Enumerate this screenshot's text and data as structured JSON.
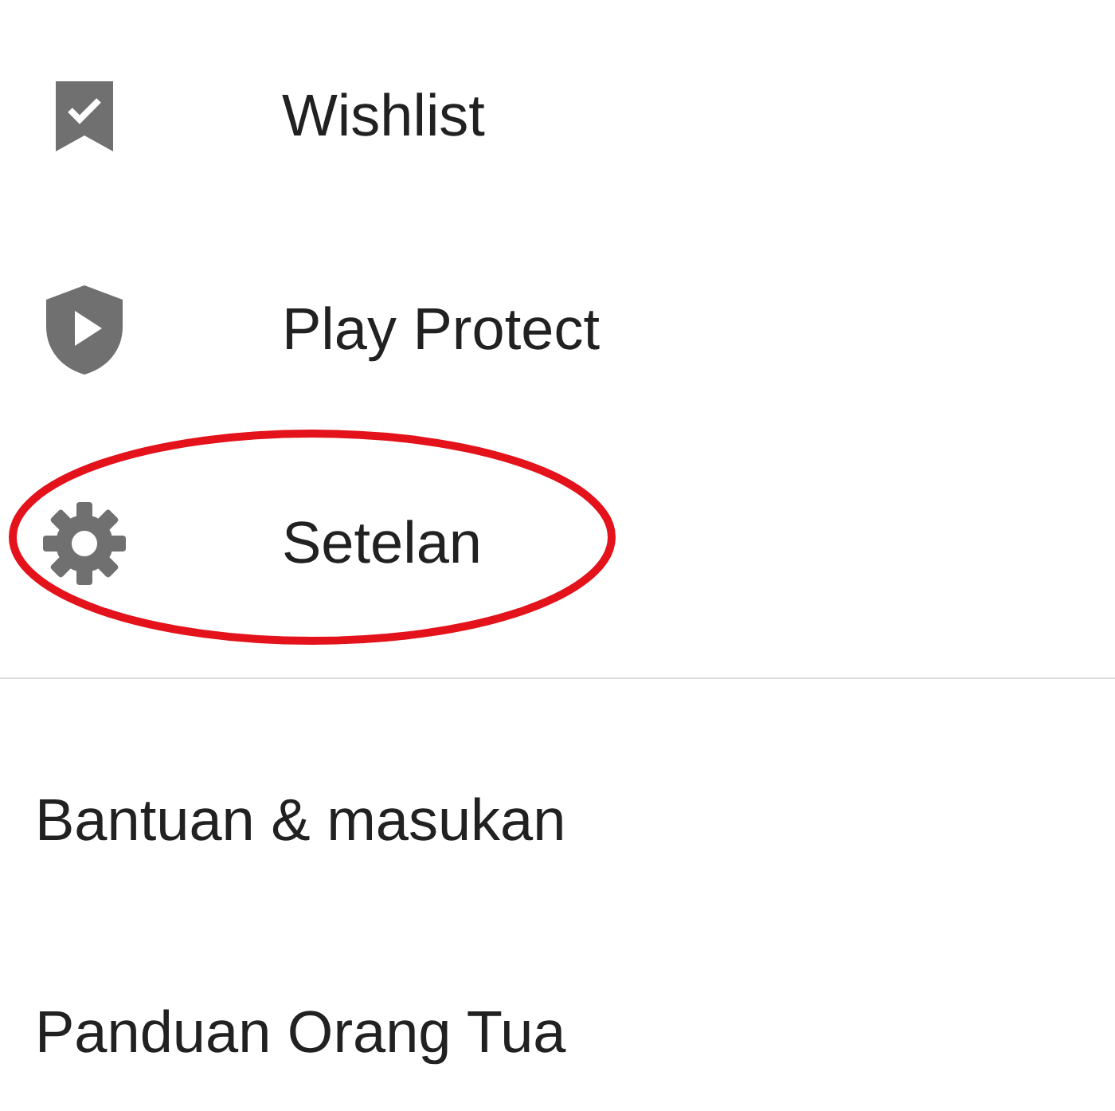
{
  "menu_items": [
    {
      "kind": "wishlist",
      "label": "Wishlist",
      "highlighted": false
    },
    {
      "kind": "protect",
      "label": "Play Protect",
      "highlighted": false
    },
    {
      "kind": "settings",
      "label": "Setelan",
      "highlighted": true
    }
  ],
  "secondary_items": [
    {
      "label": "Bantuan & masukan"
    },
    {
      "label": "Panduan Orang Tua"
    }
  ]
}
